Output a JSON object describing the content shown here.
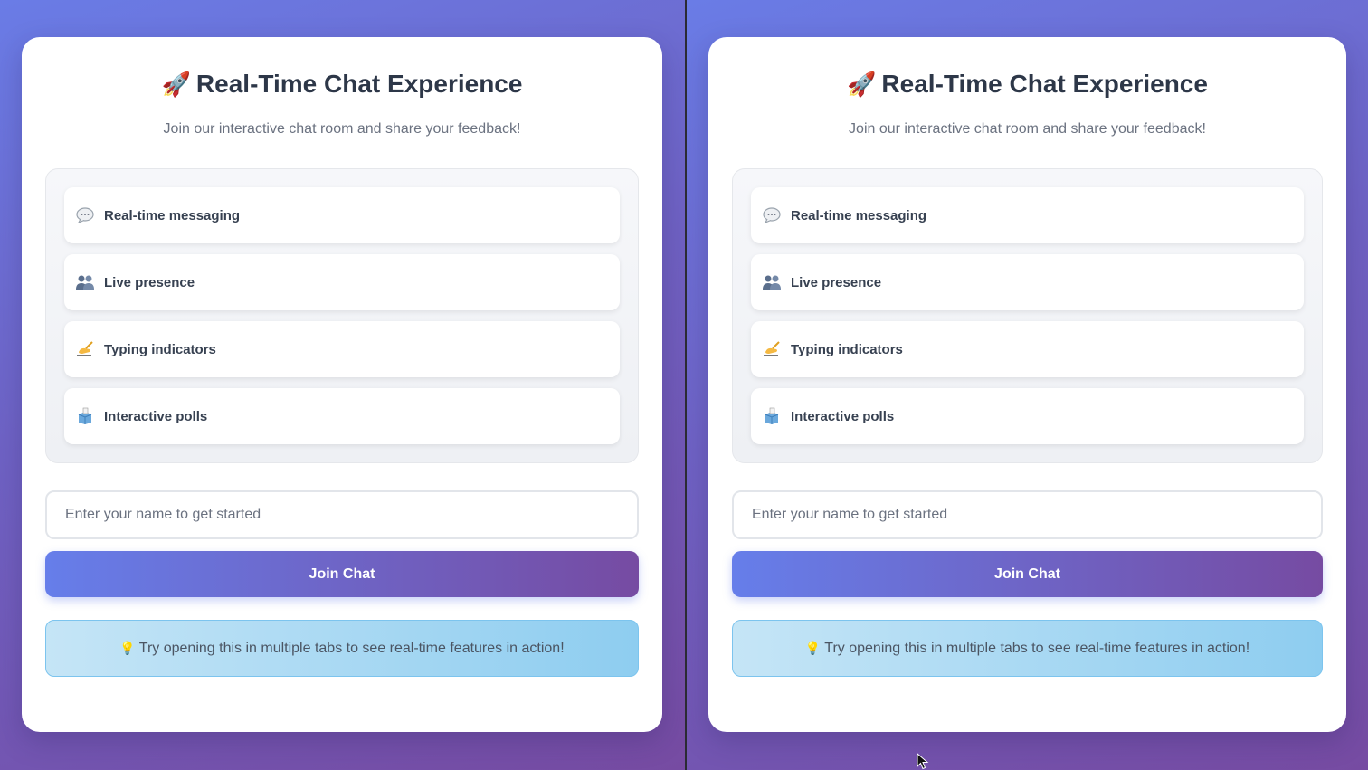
{
  "colors": {
    "background_gradient_start": "#667eea",
    "background_gradient_end": "#764ba2",
    "card_bg": "#ffffff",
    "title_text": "#2d3748",
    "button_gradient_start": "#667eea",
    "button_gradient_end": "#764ba2",
    "tip_bg": "#b8def4",
    "tip_border": "#7cc4ee"
  },
  "panes": [
    {
      "title_icon": "🚀",
      "title": "Real-Time Chat Experience",
      "subtitle": "Join our interactive chat room and share your feedback!",
      "features": [
        {
          "icon": "speech-bubble-icon",
          "glyph": "💬",
          "label": "Real-time messaging"
        },
        {
          "icon": "people-icon",
          "glyph": "👥",
          "label": "Live presence"
        },
        {
          "icon": "writing-hand-icon",
          "glyph": "✍️",
          "label": "Typing indicators"
        },
        {
          "icon": "ballot-box-icon",
          "glyph": "🗳️",
          "label": "Interactive polls"
        }
      ],
      "name_input": {
        "value": "",
        "placeholder": "Enter your name to get started"
      },
      "join_button": "Join Chat",
      "tip_icon": "💡",
      "tip": "Try opening this in multiple tabs to see real-time features in action!"
    },
    {
      "title_icon": "🚀",
      "title": "Real-Time Chat Experience",
      "subtitle": "Join our interactive chat room and share your feedback!",
      "features": [
        {
          "icon": "speech-bubble-icon",
          "glyph": "💬",
          "label": "Real-time messaging"
        },
        {
          "icon": "people-icon",
          "glyph": "👥",
          "label": "Live presence"
        },
        {
          "icon": "writing-hand-icon",
          "glyph": "✍️",
          "label": "Typing indicators"
        },
        {
          "icon": "ballot-box-icon",
          "glyph": "🗳️",
          "label": "Interactive polls"
        }
      ],
      "name_input": {
        "value": "",
        "placeholder": "Enter your name to get started"
      },
      "join_button": "Join Chat",
      "tip_icon": "💡",
      "tip": "Try opening this in multiple tabs to see real-time features in action!"
    }
  ]
}
